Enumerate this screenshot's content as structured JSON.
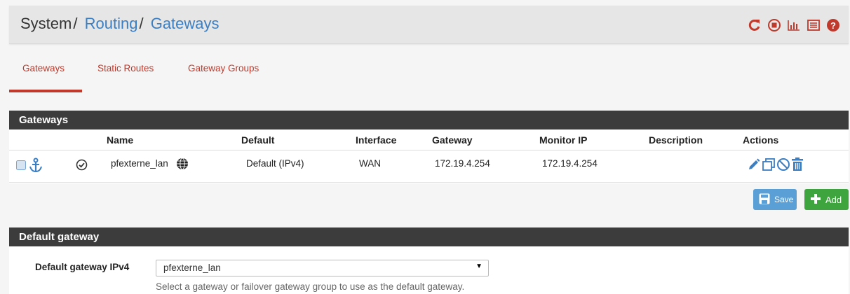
{
  "breadcrumb": {
    "section": "System",
    "sep1": "/",
    "sub": "Routing",
    "sep2": "/",
    "page": "Gateways"
  },
  "header_icons": [
    "reload-icon",
    "stop-icon",
    "chart-icon",
    "log-icon",
    "help-icon"
  ],
  "tabs": [
    {
      "label": "Gateways",
      "active": true
    },
    {
      "label": "Static Routes",
      "active": false
    },
    {
      "label": "Gateway Groups",
      "active": false
    }
  ],
  "gateways_panel": {
    "title": "Gateways",
    "columns": [
      "Name",
      "Default",
      "Interface",
      "Gateway",
      "Monitor IP",
      "Description",
      "Actions"
    ],
    "rows": [
      {
        "name": "pfexterne_lan",
        "default": "Default (IPv4)",
        "interface": "WAN",
        "gateway": "172.19.4.254",
        "monitor_ip": "172.19.4.254",
        "description": ""
      }
    ]
  },
  "buttons": {
    "save": "Save",
    "add": "Add"
  },
  "default_gateway_panel": {
    "title": "Default gateway",
    "ipv4_label": "Default gateway IPv4",
    "ipv4_value": "pfexterne_lan",
    "help": "Select a gateway or failover gateway group to use as the default gateway."
  },
  "colors": {
    "accent": "#c0392b",
    "link": "#3a7ec4",
    "panel_head": "#3c3c3c",
    "save": "#5a9fd6",
    "add": "#3ea43e"
  }
}
